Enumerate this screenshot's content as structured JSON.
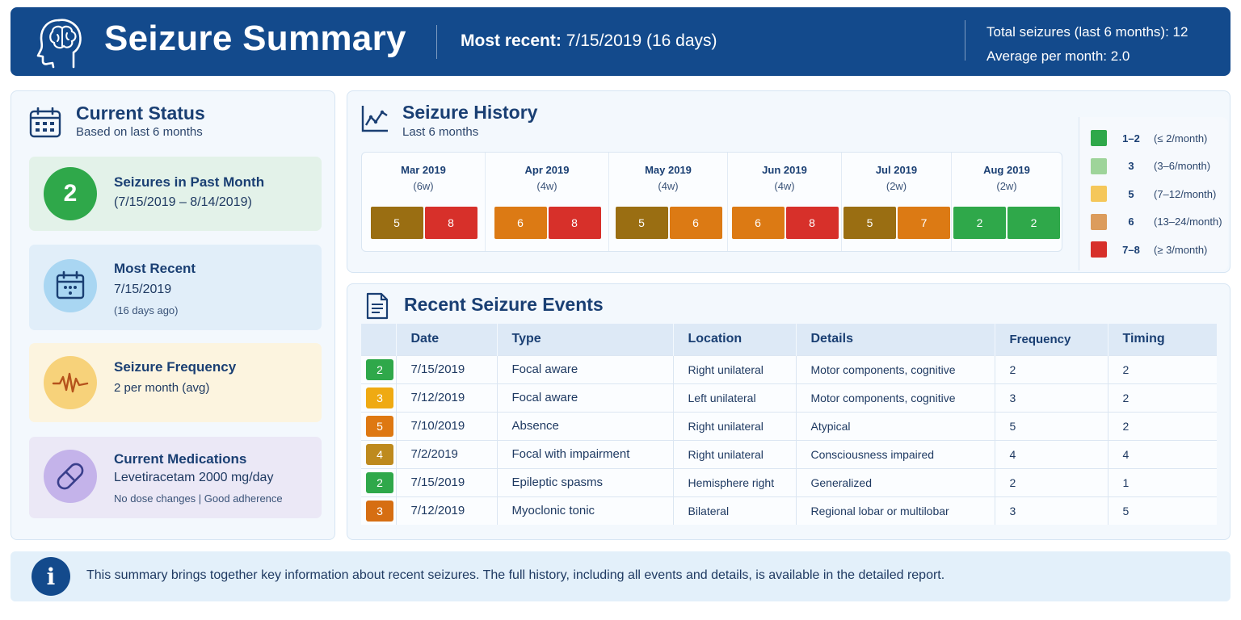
{
  "header": {
    "title": "Seizure Summary",
    "recent_label": "Most recent:",
    "recent_value": "7/15/2019 (16 days)",
    "total_line": "Total seizures (last 6 months): 12",
    "average_line": "Average per month: 2.0"
  },
  "status": {
    "title": "Current Status",
    "subtitle": "Based on last 6 months",
    "past_month": {
      "count": "2",
      "title": "Seizures in Past Month",
      "range": "(7/15/2019 – 8/14/2019)"
    },
    "most_recent": {
      "title": "Most Recent",
      "date": "7/15/2019",
      "ago": "(16 days ago)"
    },
    "frequency": {
      "title": "Seizure Frequency",
      "value": "2 per month (avg)"
    },
    "medications": {
      "title": "Current Medications",
      "drug": "Levetiracetam 2000 mg/day",
      "note": "No dose changes | Good adherence"
    }
  },
  "history": {
    "title": "Seizure History",
    "subtitle": "Last 6 months",
    "months": [
      {
        "name": "Mar 2019",
        "weeks": "(6w)",
        "values": [
          "5",
          "8"
        ]
      },
      {
        "name": "Apr 2019",
        "weeks": "(4w)",
        "values": [
          "6",
          "8"
        ]
      },
      {
        "name": "May 2019",
        "weeks": "(4w)",
        "values": [
          "5",
          "6"
        ]
      },
      {
        "name": "Jun 2019",
        "weeks": "(4w)",
        "values": [
          "6",
          "8"
        ]
      },
      {
        "name": "Jul 2019",
        "weeks": "(2w)",
        "values": [
          "5",
          "7"
        ]
      },
      {
        "name": "Aug 2019",
        "weeks": "(2w)",
        "values": [
          "2",
          "2"
        ]
      }
    ],
    "legend": [
      {
        "value": "1–2",
        "range": "(≤ 2/month)",
        "color": "#2fa84a"
      },
      {
        "value": "3",
        "range": "(3–6/month)",
        "color": "#9ed49a"
      },
      {
        "value": "5",
        "range": "(7–12/month)",
        "color": "#f5c75a"
      },
      {
        "value": "6",
        "range": "(13–24/month)",
        "color": "#dc9c5c"
      },
      {
        "value": "7–8",
        "range": "(≥ 3/month)",
        "color": "#d7302a"
      }
    ],
    "level_colors": {
      "2": "#2fa84a",
      "5": "#9a6e12",
      "6": "#dc7a14",
      "7": "#dc7a14",
      "8": "#d7302a"
    }
  },
  "events": {
    "title": "Recent Seizure Events",
    "columns": [
      "",
      "Date",
      "Type",
      "Location",
      "Details",
      "Frequency",
      "Timing"
    ],
    "rows": [
      {
        "level": "2",
        "color": "#2fa84a",
        "date": "7/15/2019",
        "type": "Focal aware",
        "location": "Right unilateral",
        "details": "Motor components, cognitive",
        "frequency": "2",
        "timing": "2"
      },
      {
        "level": "3",
        "color": "#efaa12",
        "date": "7/12/2019",
        "type": "Focal aware",
        "location": "Left unilateral",
        "details": "Motor components, cognitive",
        "frequency": "3",
        "timing": "2"
      },
      {
        "level": "5",
        "color": "#de7812",
        "date": "7/10/2019",
        "type": "Absence",
        "location": "Right unilateral",
        "details": "Atypical",
        "frequency": "5",
        "timing": "2"
      },
      {
        "level": "4",
        "color": "#be8a1e",
        "date": "7/2/2019",
        "type": "Focal with impairment",
        "location": "Right unilateral",
        "details": "Consciousness impaired",
        "frequency": "4",
        "timing": "4"
      },
      {
        "level": "2",
        "color": "#2fa84a",
        "date": "7/15/2019",
        "type": "Epileptic spasms",
        "location": "Hemisphere right",
        "details": "Generalized",
        "frequency": "2",
        "timing": "1"
      },
      {
        "level": "3",
        "color": "#d66e12",
        "date": "7/12/2019",
        "type": "Myoclonic tonic",
        "location": "Bilateral",
        "details": "Regional lobar or multilobar",
        "frequency": "3",
        "timing": "5"
      }
    ]
  },
  "info": {
    "text": "This summary brings together key information about recent seizures. The full history, including all events and details, is available in the detailed report."
  },
  "icons": {
    "header": "brain-head-icon",
    "status": "calendar-icon",
    "recent": "calendar-icon",
    "frequency": "pulse-icon",
    "medication": "pill-icon",
    "history": "line-chart-icon",
    "events": "document-icon",
    "info": "info-icon"
  }
}
